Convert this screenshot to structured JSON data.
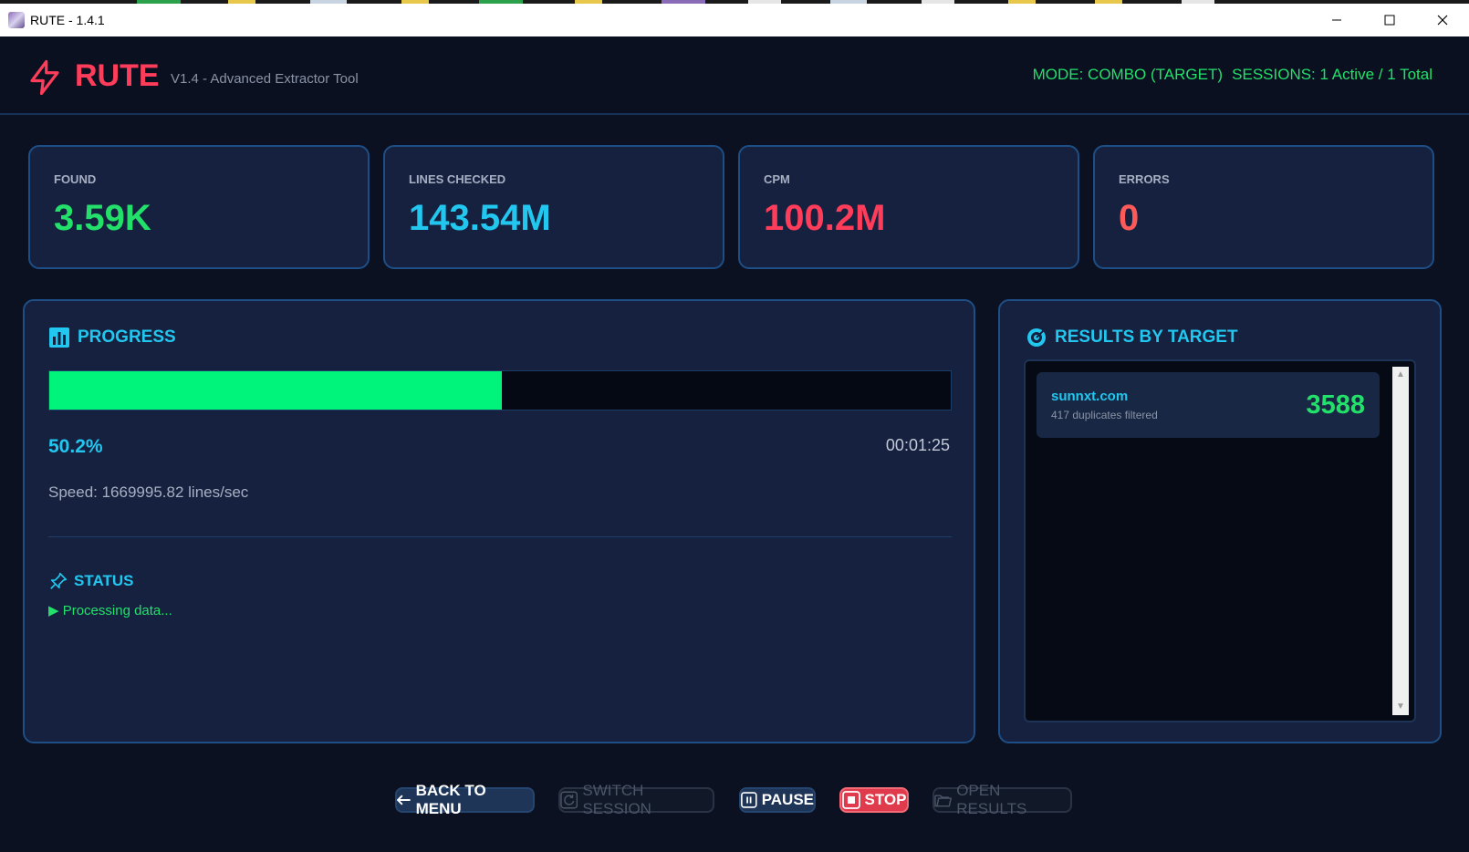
{
  "window": {
    "title": "RUTE - 1.4.1"
  },
  "header": {
    "logo_text": "RUTE",
    "subtitle": "V1.4 - Advanced Extractor Tool",
    "mode": "MODE: COMBO (TARGET)",
    "sessions": "SESSIONS: 1 Active / 1 Total"
  },
  "stats": [
    {
      "label": "FOUND",
      "value": "3.59K",
      "color": "#22e06a"
    },
    {
      "label": "LINES CHECKED",
      "value": "143.54M",
      "color": "#22c7f0"
    },
    {
      "label": "CPM",
      "value": "100.2M",
      "color": "#ff3d5a"
    },
    {
      "label": "ERRORS",
      "value": "0",
      "color": "#ff5a5a"
    }
  ],
  "progress": {
    "title": "PROGRESS",
    "fraction": 0.502,
    "percent_text": "50.2%",
    "elapsed": "00:01:25",
    "speed": "Speed: 1669995.82 lines/sec",
    "bar_color": "#00f47c"
  },
  "status": {
    "title": "STATUS",
    "line": "▶ Processing data..."
  },
  "results": {
    "title": "RESULTS BY TARGET",
    "items": [
      {
        "domain": "sunnxt.com",
        "sub": "417 duplicates filtered",
        "count": "3588"
      }
    ]
  },
  "buttons": {
    "back": "BACK TO MENU",
    "switch": "SWITCH SESSION",
    "pause": "PAUSE",
    "stop": "STOP",
    "open": "OPEN RESULTS"
  },
  "icons": {
    "logo": "lightning-bolt-icon",
    "progress": "bar-chart-icon",
    "status": "pin-icon",
    "results": "target-icon",
    "back": "arrow-left-icon",
    "switch": "refresh-icon",
    "pause": "pause-icon",
    "stop": "stop-icon",
    "open": "folder-icon"
  }
}
